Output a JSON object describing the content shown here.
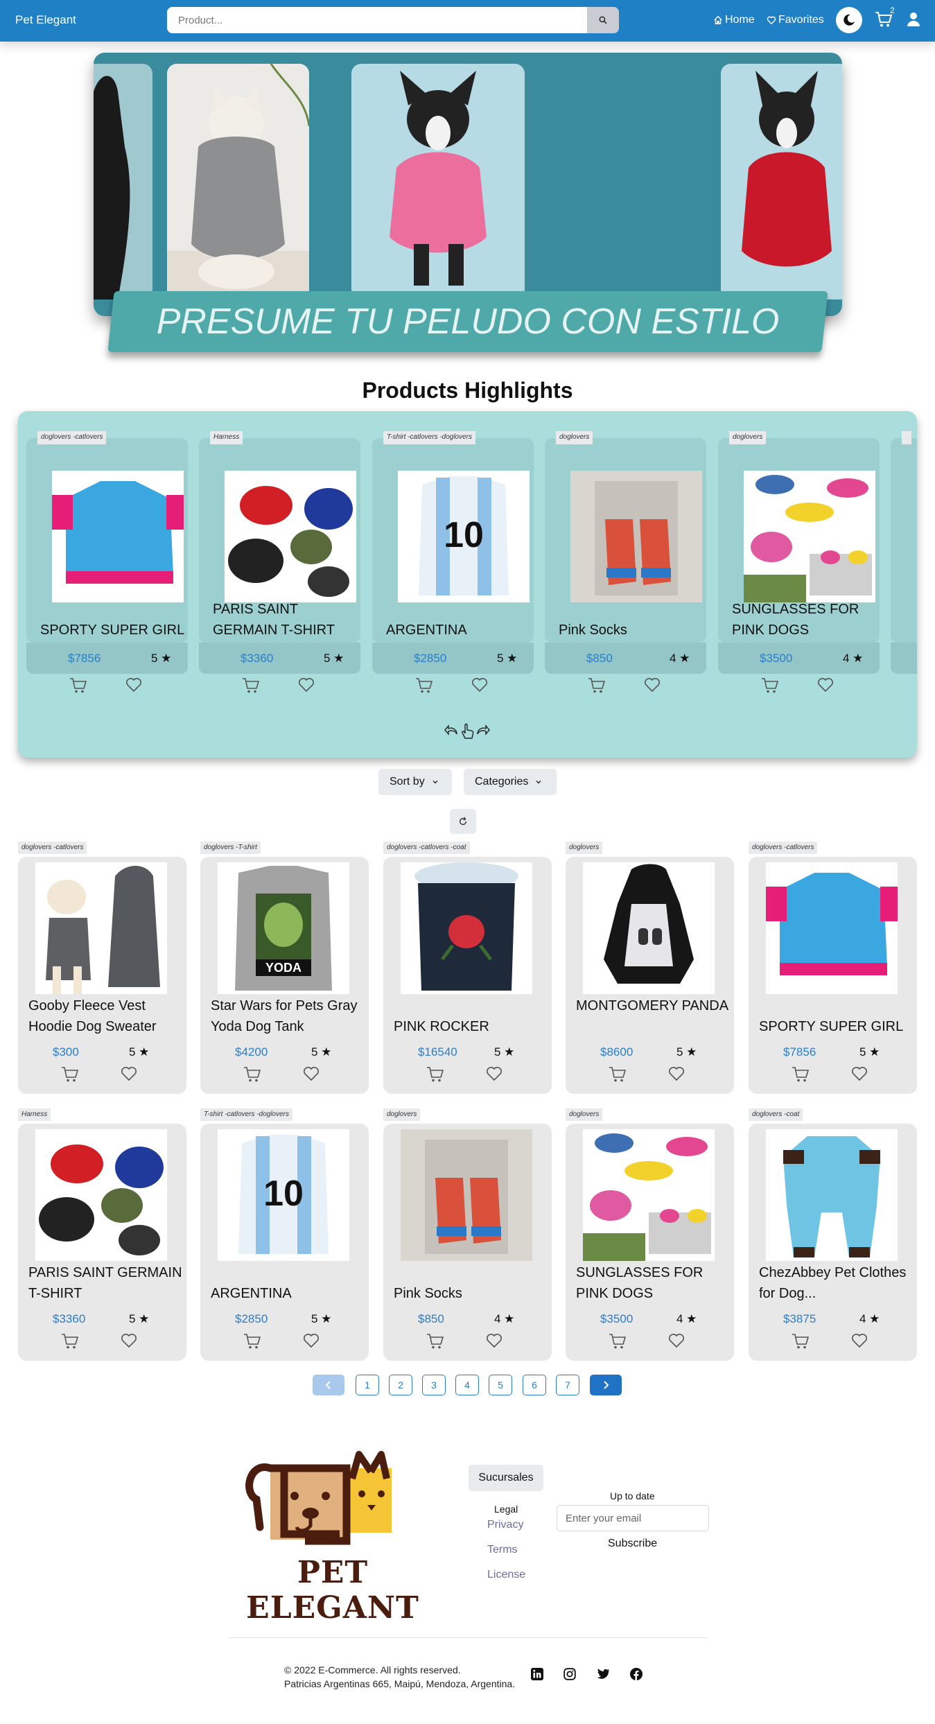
{
  "navbar": {
    "brand": "Pet Elegant",
    "search_placeholder": "Product...",
    "home": "Home",
    "favorites": "Favorites",
    "cart_count": "2",
    "color": "#1f80c6"
  },
  "hero": {
    "banner_text": "PRESUME TU PELUDO CON ESTILO"
  },
  "highlights": {
    "title": "Products Highlights",
    "cards": [
      {
        "tag": "doglovers -catlovers",
        "name": "SPORTY SUPER GIRL",
        "price": "$7856",
        "rating": "5 ★"
      },
      {
        "tag": "Harness",
        "name": "PARIS SAINT GERMAIN T-SHIRT",
        "price": "$3360",
        "rating": "5 ★"
      },
      {
        "tag": "T-shirt -catlovers -doglovers",
        "name": "ARGENTINA",
        "price": "$2850",
        "rating": "5 ★"
      },
      {
        "tag": "doglovers",
        "name": "Pink Socks",
        "price": "$850",
        "rating": "4 ★"
      },
      {
        "tag": "doglovers",
        "name": "SUNGLASSES FOR PINK DOGS",
        "price": "$3500",
        "rating": "4 ★"
      }
    ]
  },
  "filters": {
    "sort_label": "Sort by",
    "categories_label": "Categories"
  },
  "products": [
    {
      "tag": "doglovers -catlovers",
      "name": "Gooby Fleece Vest Hoodie Dog Sweater",
      "price": "$300",
      "rating": "5 ★"
    },
    {
      "tag": "doglovers -T-shirt",
      "name": "Star Wars for Pets Gray Yoda Dog Tank",
      "price": "$4200",
      "rating": "5 ★"
    },
    {
      "tag": "doglovers -catlovers -coat",
      "name": "PINK ROCKER",
      "price": "$16540",
      "rating": "5 ★"
    },
    {
      "tag": "doglovers",
      "name": "MONTGOMERY PANDA",
      "price": "$8600",
      "rating": "5 ★"
    },
    {
      "tag": "doglovers -catlovers",
      "name": "SPORTY SUPER GIRL",
      "price": "$7856",
      "rating": "5 ★"
    },
    {
      "tag": "Harness",
      "name": "PARIS SAINT GERMAIN T-SHIRT",
      "price": "$3360",
      "rating": "5 ★"
    },
    {
      "tag": "T-shirt -catlovers -doglovers",
      "name": "ARGENTINA",
      "price": "$2850",
      "rating": "5 ★"
    },
    {
      "tag": "doglovers",
      "name": "Pink Socks",
      "price": "$850",
      "rating": "4 ★"
    },
    {
      "tag": "doglovers",
      "name": "SUNGLASSES FOR PINK DOGS",
      "price": "$3500",
      "rating": "4 ★"
    },
    {
      "tag": "doglovers -coat",
      "name": "ChezAbbey Pet Clothes for Dog...",
      "price": "$3875",
      "rating": "4 ★"
    }
  ],
  "pagination": {
    "pages": [
      "1",
      "2",
      "3",
      "4",
      "5",
      "6",
      "7"
    ]
  },
  "footer": {
    "brand_word": "PET ELEGANT",
    "sucursales": "Sucursales",
    "legal_heading": "Legal",
    "legal_links": [
      "Privacy",
      "Terms",
      "License"
    ],
    "newsletter_heading": "Up to date",
    "email_placeholder": "Enter your email",
    "subscribe_label": "Subscribe",
    "copyright": "© 2022 E-Commerce. All rights reserved.",
    "address": "Patricias Argentinas 665, Maipú, Mendoza, Argentina."
  },
  "icons": [
    "search-icon",
    "home-icon",
    "heart-icon",
    "moon-icon",
    "cart-icon",
    "user-icon",
    "refresh-icon",
    "chevron-down-icon",
    "linkedin-icon",
    "instagram-icon",
    "twitter-icon",
    "facebook-icon"
  ]
}
